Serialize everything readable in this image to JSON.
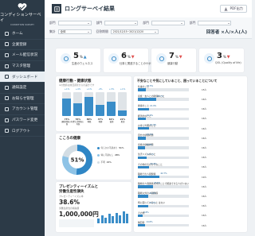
{
  "app": {
    "logo_text": "コンディションサーベイ",
    "logo_sub": "CONDITION SURVEY"
  },
  "sidebar": {
    "items": [
      {
        "label": "ホーム",
        "icon": "home-icon"
      },
      {
        "label": "企業登録",
        "icon": "building-icon"
      },
      {
        "label": "メール配信状況",
        "icon": "mail-icon"
      },
      {
        "label": "マスタ管理",
        "icon": "database-icon"
      },
      {
        "label": "ダッシュボード",
        "icon": "dashboard-icon",
        "active": true
      },
      {
        "label": "通知設定",
        "icon": "bell-icon"
      },
      {
        "label": "お知らせ管理",
        "icon": "megaphone-icon"
      },
      {
        "label": "アカウント管理",
        "icon": "user-icon"
      },
      {
        "label": "パスワード変更",
        "icon": "key-icon"
      },
      {
        "label": "ログアウト",
        "icon": "logout-icon"
      }
    ]
  },
  "header": {
    "title": "ロングサーベイ結果",
    "pdf_button": "PDF出力"
  },
  "filters": {
    "row1_label1": "部門",
    "row1_label2": "部門",
    "row1_label3": "部門",
    "row1_label4": "部門",
    "row2_label1": "集計",
    "row2_value1": "全体",
    "row2_label2": "回答期間",
    "row2_value2": "2021/12/15~2021/12/20",
    "respondents": "回答者 ×人/×人(人)"
  },
  "kpis": [
    {
      "value": "5",
      "unit": "%",
      "label": "生産のウェルネス",
      "icon": "heart-pulse-icon",
      "color": "#3a8dc8"
    },
    {
      "value": "6",
      "unit": "%",
      "label": "仕事と関連することのサポート",
      "icon": "handshake-icon",
      "color": "#e0504f"
    },
    {
      "value": "7",
      "unit": "%",
      "label": "健康行動",
      "icon": "running-icon",
      "color": "#e0504f"
    },
    {
      "value": "3",
      "unit": "%",
      "label": "QOL (Quality of life)",
      "icon": "smile-icon",
      "color": "#e0504f"
    }
  ],
  "health_card": {
    "title": "健康行動・健康状態",
    "subtitle": "※の数値は前回調査からの差分です",
    "items": [
      {
        "label": "運動習慣の有無",
        "pct": "73%",
        "delta": "+1%"
      },
      {
        "label": "食生活習慣の有無",
        "pct": "54%",
        "delta": "+4%"
      },
      {
        "label": "睡眠",
        "pct": "80%",
        "delta": "+1%"
      },
      {
        "label": "喫煙",
        "pct": "47%",
        "delta": "-4%"
      },
      {
        "label": "飲酒",
        "pct": "61%",
        "delta": "+3%"
      },
      {
        "label": "肥満",
        "pct": "22%",
        "delta": "+1%"
      }
    ]
  },
  "mind_card": {
    "title": "こころの健康",
    "center_value": "51%",
    "legend": [
      {
        "label": "何らかの不調あり",
        "value": "51%",
        "color": "#2f86c5"
      },
      {
        "label": "特に不調なし",
        "value": "28%",
        "color": "#8ec3e6"
      },
      {
        "label": "不明",
        "value": "21%",
        "color": "#d3dde4"
      }
    ]
  },
  "presenteeism_card": {
    "title": "プレゼンティーイズムと",
    "title2": "労働生産性損失",
    "subtitle": "プレゼンティーイズム率",
    "rate": "38.6%",
    "loss_label": "労働生産性の損失額",
    "loss_value": "1,000,000円"
  },
  "issues_card": {
    "title": "不安なことや気にしていること、困っていることについて",
    "items": [
      {
        "label": "仕事のこと",
        "pct": "15.5%",
        "count": "15人",
        "fill": 0.155
      },
      {
        "label": "家族・友人との関係のこと",
        "pct": "35.7%",
        "count": "16人",
        "fill": 0.357
      },
      {
        "label": "健康のこと",
        "pct": "21.9%",
        "count": "16人",
        "fill": 0.219
      },
      {
        "label": "経済的なこと",
        "pct": "15.3%",
        "count": "16人",
        "fill": 0.153
      },
      {
        "label": "お金と貯蓄のこと",
        "pct": "21.9%",
        "count": "16人",
        "fill": 0.219
      },
      {
        "label": "自分の健康状態",
        "pct": "15.5%",
        "count": "16人",
        "fill": 0.155
      },
      {
        "label": "家族の健康状態",
        "pct": "14.6%",
        "count": "16人",
        "fill": 0.146
      },
      {
        "label": "生活リズムのこと",
        "pct": "17.1%",
        "count": "16人",
        "fill": 0.171
      },
      {
        "label": "その他の気がかりなこと",
        "pct": "22.6%",
        "count": "16人",
        "fill": 0.226
      },
      {
        "label": "職場での人間関係",
        "pct": "42.7%",
        "count": "19人",
        "fill": 0.427
      },
      {
        "label": "職場の人間関係以外のことで相談できる人がいない",
        "pct": "29.6%",
        "count": "16人",
        "fill": 0.296
      },
      {
        "label": "職場以外の人間関係",
        "pct": "21.0%",
        "count": "16人",
        "fill": 0.21
      },
      {
        "label": "特に困っていること はない",
        "pct": "21.0%",
        "count": "16人",
        "fill": 0.21
      },
      {
        "label": "その他",
        "pct": "9.6%",
        "count": "16人",
        "fill": 0.096
      },
      {
        "label": "無回答",
        "pct": "14.6%",
        "count": "16人",
        "fill": 0.146
      }
    ]
  },
  "colors": {
    "sidebar": "#2c3a47",
    "accent": "#3a8dc8",
    "alert": "#e0504f"
  }
}
